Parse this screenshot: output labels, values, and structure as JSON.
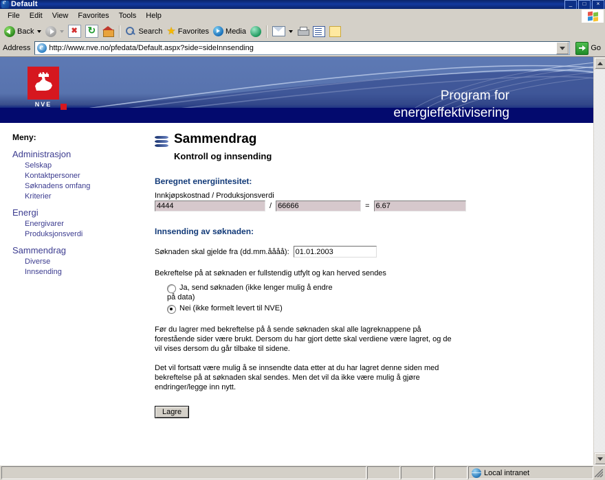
{
  "window": {
    "title": "Default",
    "icon": "ie-icon",
    "buttons": [
      {
        "name": "minimize-button",
        "glyph": "_"
      },
      {
        "name": "maximize-button",
        "glyph": "□"
      },
      {
        "name": "close-button",
        "glyph": "×"
      }
    ]
  },
  "menubar": {
    "items": [
      {
        "label": "File",
        "accel": "F"
      },
      {
        "label": "Edit",
        "accel": "E"
      },
      {
        "label": "View",
        "accel": "V"
      },
      {
        "label": "Favorites",
        "accel": "a"
      },
      {
        "label": "Tools",
        "accel": "T"
      },
      {
        "label": "Help",
        "accel": "H"
      }
    ],
    "brand_icon": "windows-flag-icon"
  },
  "toolbar": {
    "back_label": "Back",
    "forward_label": "",
    "stop_icon": "stop-icon",
    "refresh_icon": "refresh-icon",
    "home_icon": "home-icon",
    "search_label": "Search",
    "favorites_label": "Favorites",
    "media_label": "Media",
    "history_icon": "history-icon",
    "mail_icon": "mail-icon",
    "print_icon": "print-icon",
    "edit_icon": "edit-icon",
    "discuss_icon": "notes-icon"
  },
  "address": {
    "label": "Address",
    "url": "http://www.nve.no/pfedata/Default.aspx?side=sideInnsending",
    "go_label": "Go",
    "favicon": "ie-icon"
  },
  "banner": {
    "logo_text": "NVE",
    "title_line1": "Program for",
    "title_line2": "energieffektivisering"
  },
  "sidebar": {
    "heading": "Meny:",
    "groups": [
      {
        "label": "Administrasjon",
        "items": [
          "Selskap",
          "Kontaktpersoner",
          "Søknadens omfang",
          "Kriterier"
        ]
      },
      {
        "label": "Energi",
        "items": [
          "Energivarer",
          "Produksjonsverdi"
        ]
      },
      {
        "label": "Sammendrag",
        "items": [
          "Diverse",
          "Innsending"
        ]
      }
    ]
  },
  "main": {
    "icon": "wave-stack-icon",
    "title": "Sammendrag",
    "subtitle": "Kontroll og innsending",
    "section1_label": "Beregnet energiintesitet:",
    "formula_header": "Innkjøpskostnad / Produksjonsverdi",
    "numerator": "4444",
    "divider": "/",
    "denominator": "66666",
    "equals": "=",
    "result": "6.67",
    "section2_label": "Innsending av søknaden:",
    "date_label": "Søknaden skal gjelde fra (dd.mm.åååå):",
    "date_value": "01.01.2003",
    "confirm_text": "Bekreftelse på at søknaden er fullstendig utfylt og kan herved sendes",
    "radio_yes_line1": "Ja, send søknaden (ikke lenger mulig å endre",
    "radio_yes_line2": "på data)",
    "radio_no": "Nei (ikke formelt levert til NVE)",
    "radio_selected": "no",
    "paragraph1": "Før du lagrer med bekreftelse på å sende søknaden skal alle lagreknappene på forestående sider være brukt. Dersom du har gjort dette skal verdiene være lagret, og de vil vises dersom du går tilbake til sidene.",
    "paragraph2": "Det vil fortsatt være mulig å se innsendte data etter at du har lagret denne siden med bekreftelse på at søknaden skal sendes. Men det vil da ikke være mulig å gjøre endringer/legge inn nytt.",
    "save_label": "Lagre"
  },
  "statusbar": {
    "message": "",
    "zone": "Local intranet",
    "zone_icon": "globe-icon"
  },
  "colors": {
    "chrome": "#d4d0c8",
    "titlebar": "#0a246a",
    "banner_blue": "#5571ad",
    "banner_dark": "#030a6e",
    "link": "#3b3b8f",
    "heading": "#123a78",
    "logo_red": "#d6171f",
    "readonly_field": "#d6c8cc"
  }
}
